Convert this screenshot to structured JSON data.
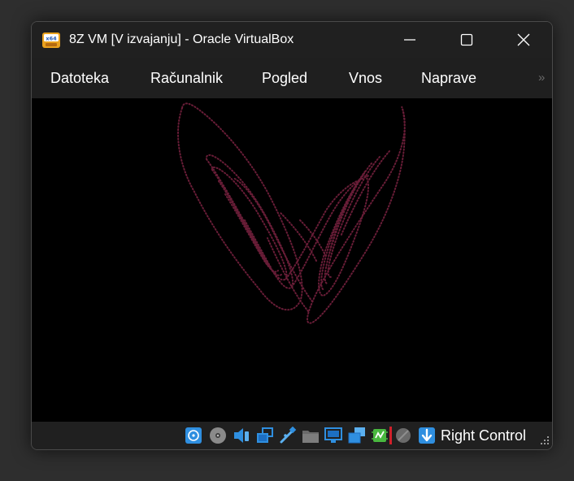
{
  "window": {
    "title": "8Z VM [V izvajanju] - Oracle VirtualBox",
    "app_icon": "virtualbox-x64-icon",
    "app_icon_label": "x64"
  },
  "menu": {
    "items": [
      "Datoteka",
      "Računalnik",
      "Pogled",
      "Vnos",
      "Naprave"
    ],
    "more_label": "»"
  },
  "screen": {
    "content": "lorenz-attractor-butterfly",
    "background": "#000000",
    "stroke_color": "#6e1f3a"
  },
  "statusbar": {
    "icons": [
      "hard-disk-icon",
      "optical-drive-icon",
      "audio-icon",
      "network-icon",
      "usb-icon",
      "shared-folders-icon",
      "display-icon",
      "recording-icon",
      "cpu-activity-icon",
      "mouse-integration-icon",
      "keyboard-capture-icon"
    ],
    "host_key": "Right Control"
  },
  "colors": {
    "titlebar": "#202020",
    "text": "#ffffff",
    "accent_blue": "#2f8fe0",
    "accent_green": "#49b83f"
  }
}
